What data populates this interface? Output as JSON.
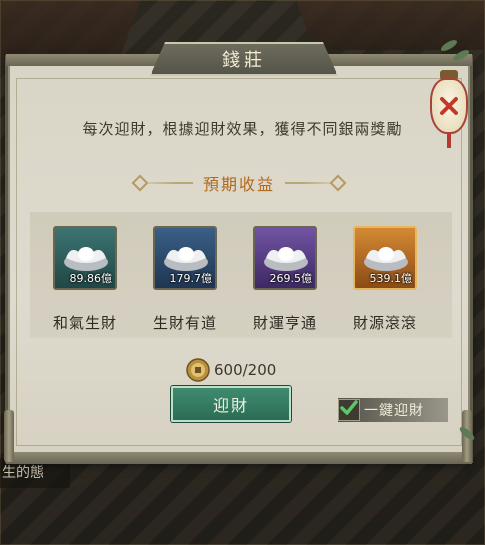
{
  "background": {
    "side_text": "生的態"
  },
  "dialog": {
    "title": "錢莊",
    "description": "每次迎財，根據迎財效果，獲得不同銀兩獎勵",
    "section_title": "預期收益",
    "rewards": [
      {
        "amount": "89.86億",
        "name": "和氣生財",
        "rarity": "teal"
      },
      {
        "amount": "179.7億",
        "name": "生財有道",
        "rarity": "blue"
      },
      {
        "amount": "269.5億",
        "name": "財運亨通",
        "rarity": "purple"
      },
      {
        "amount": "539.1億",
        "name": "財源滾滾",
        "rarity": "gold"
      }
    ],
    "cost": "600/200",
    "action_label": "迎財",
    "onekey_label": "一鍵迎財",
    "onekey_checked": true
  },
  "icons": {
    "close": "close-icon",
    "coin": "coin-icon",
    "ingot": "silver-ingot-icon",
    "check": "checkmark-icon"
  },
  "colors": {
    "teal": "#3c7472",
    "blue": "#3a5f86",
    "purple": "#7153a3",
    "gold": "#d48a34",
    "accent": "#b06a1f",
    "button": "#3f8b6f"
  }
}
